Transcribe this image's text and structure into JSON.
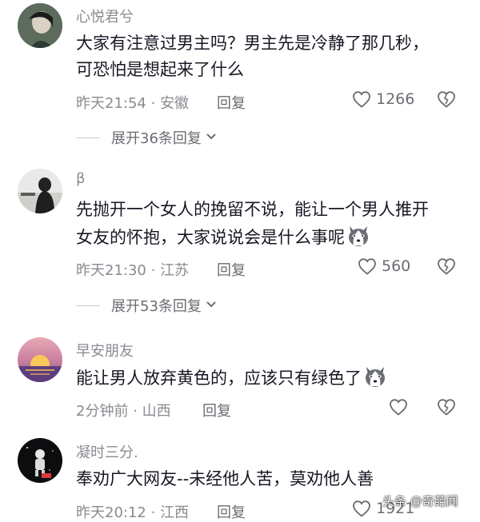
{
  "comments": [
    {
      "username": "心悦君兮",
      "text_lines": [
        "大家有注意过男主吗？男主先是冷静了那几秒，",
        "可恐怕是想起来了什么"
      ],
      "time": "昨天21:54",
      "location": "安徽",
      "reply_label": "回复",
      "likes": "1266",
      "expand_label": "展开36条回复"
    },
    {
      "username": "β",
      "text_lines": [
        "先抛开一个女人的挽留不说，能让一个男人推开",
        "女友的怀抱，大家说说会是什么事呢"
      ],
      "time": "昨天21:30",
      "location": "江苏",
      "reply_label": "回复",
      "likes": "560",
      "expand_label": "展开53条回复"
    },
    {
      "username": "早安朋友",
      "text_lines": [
        "能让男人放弃黄色的，应该只有绿色了"
      ],
      "time": "2分钟前",
      "location": "山西",
      "reply_label": "回复",
      "likes": ""
    },
    {
      "username": "凝时三分.",
      "text_lines": [
        "奉劝广大网友--未经他人苦，莫劝他人善"
      ],
      "time": "昨天20:12",
      "location": "江西",
      "reply_label": "回复",
      "likes": "1921"
    }
  ],
  "watermark": "头条 @奇葩闻",
  "icons": {
    "like": "heart-outline-icon",
    "dislike": "broken-heart-icon",
    "expand": "chevron-down-icon",
    "emoji": "husky-dog-emoji"
  },
  "colors": {
    "text": "#161823",
    "secondary": "#8a8b91",
    "divider": "#c8c9cd"
  }
}
